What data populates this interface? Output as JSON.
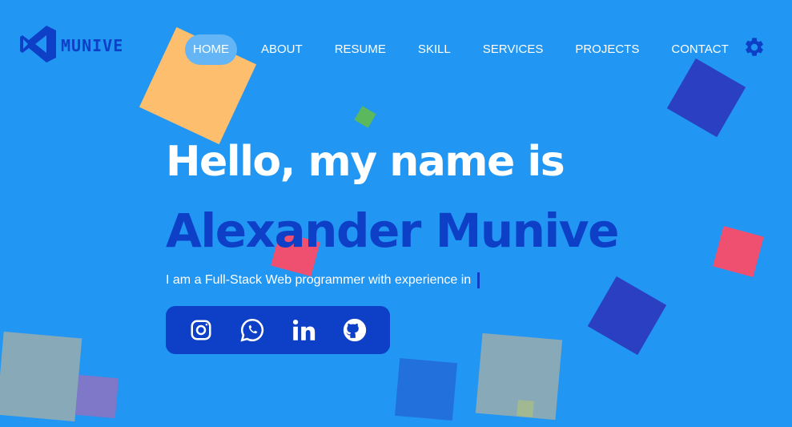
{
  "brand": {
    "name": "MUNIVE"
  },
  "nav": [
    {
      "label": "HOME",
      "active": true
    },
    {
      "label": "ABOUT",
      "active": false
    },
    {
      "label": "RESUME",
      "active": false
    },
    {
      "label": "SKILL",
      "active": false
    },
    {
      "label": "SERVICES",
      "active": false
    },
    {
      "label": "PROJECTS",
      "active": false
    },
    {
      "label": "CONTACT",
      "active": false
    }
  ],
  "hero": {
    "greeting": "Hello, my name is",
    "name": "Alexander Munive",
    "tagline": "I am a Full-Stack Web programmer with experience in"
  },
  "socials": [
    "instagram-icon",
    "whatsapp-icon",
    "linkedin-icon",
    "github-icon"
  ],
  "colors": {
    "background": "#2196f3",
    "accent": "#0d3fc7",
    "active_nav": "#64b5f6"
  }
}
